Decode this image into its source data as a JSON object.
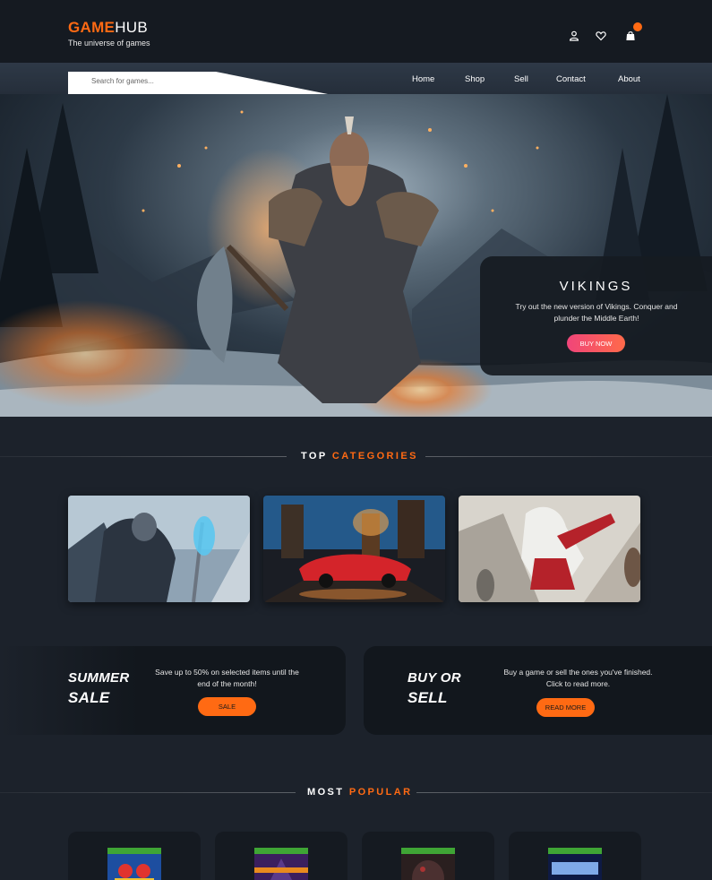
{
  "header": {
    "logo_part1": "GAME",
    "logo_part2": "HUB",
    "tagline": "The universe of games",
    "icons": [
      "user-icon",
      "heart-icon",
      "bag-icon"
    ]
  },
  "search": {
    "placeholder": "Search for games..."
  },
  "nav": {
    "items": [
      "Home",
      "Shop",
      "Sell",
      "Contact",
      "About"
    ]
  },
  "hero": {
    "title": "VIKINGS",
    "text": "Try out the new version of Vikings. Conquer and plunder the Middle Earth!",
    "button": "BUY NOW"
  },
  "top_categories": {
    "title_white": "TOP",
    "title_orange": "CATEGORIES"
  },
  "promos": [
    {
      "title_line1": "SUMMER",
      "title_line2": "SALE",
      "text": "Save up to 50% on selected items until the end of the month!",
      "button": "SALE"
    },
    {
      "title_line1": "BUY OR",
      "title_line2": "SELL",
      "text": "Buy a game or sell the ones you've finished. Click to read more.",
      "button": "READ MORE"
    }
  ],
  "most_popular": {
    "title_white": "MOST",
    "title_orange": "POPULAR"
  },
  "colors": {
    "accent": "#ff6a13",
    "background": "#1c222b",
    "header": "#151a21",
    "buy_now_gradient_start": "#f0457a"
  }
}
